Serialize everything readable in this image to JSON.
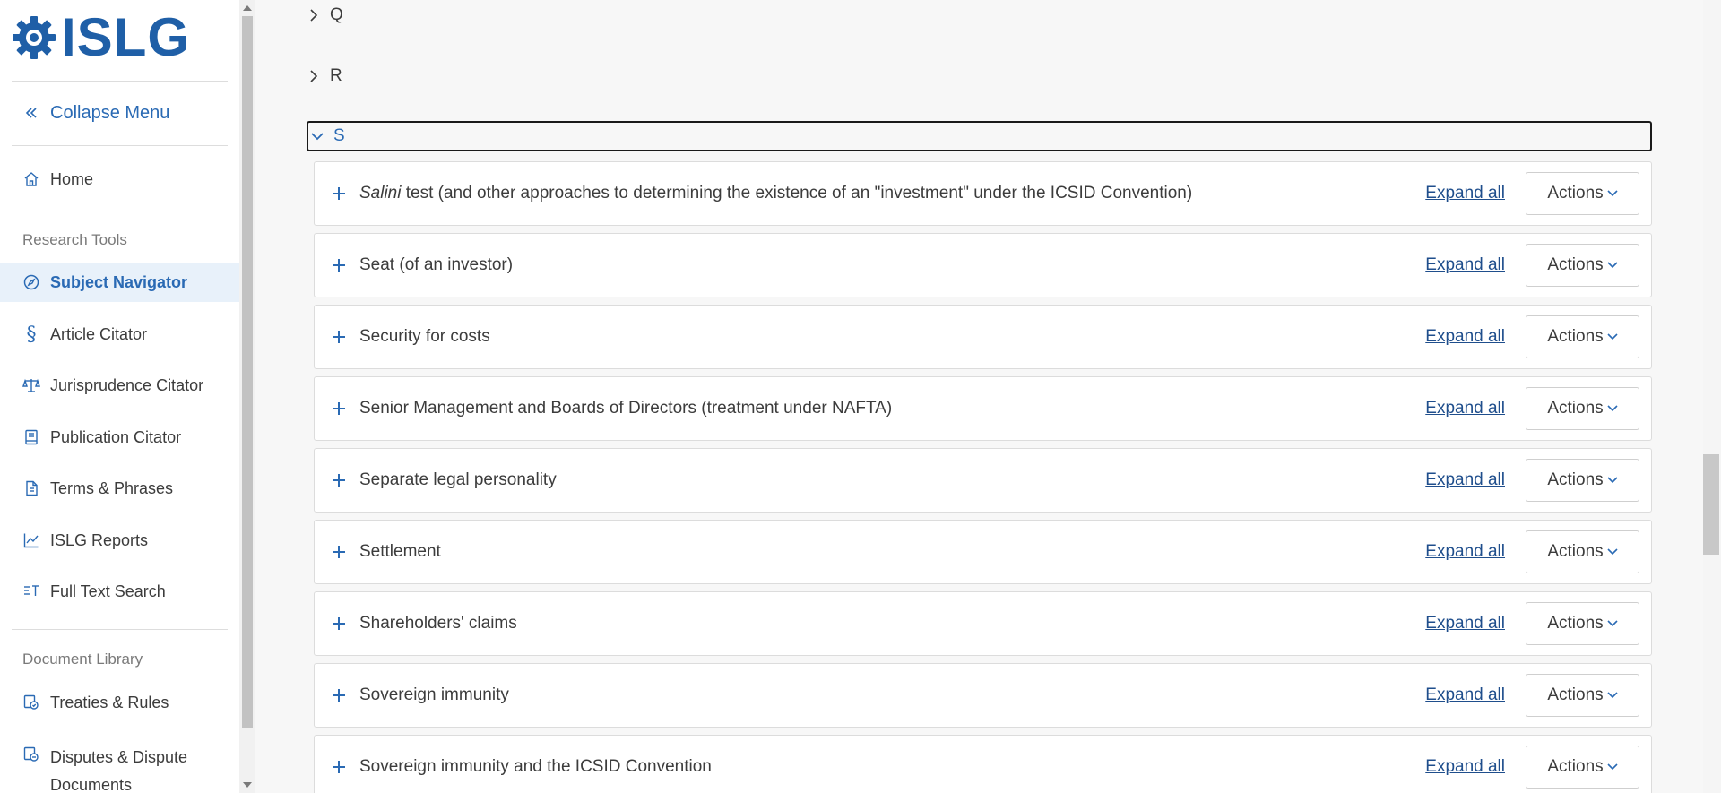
{
  "brand": {
    "name": "ISLG",
    "reg": "®",
    "icon": "gear-logo-icon"
  },
  "sidebar": {
    "collapse_label": "Collapse Menu",
    "home_label": "Home",
    "section_research": "Research Tools",
    "research_items": [
      {
        "label": "Subject Navigator",
        "icon": "compass-icon",
        "active": true
      },
      {
        "label": "Article Citator",
        "icon": "section-icon"
      },
      {
        "label": "Jurisprudence Citator",
        "icon": "scales-icon"
      },
      {
        "label": "Publication Citator",
        "icon": "book-icon"
      },
      {
        "label": "Terms & Phrases",
        "icon": "document-icon"
      },
      {
        "label": "ISLG Reports",
        "icon": "chart-line-icon"
      },
      {
        "label": "Full Text Search",
        "icon": "text-search-icon"
      }
    ],
    "section_library": "Document Library",
    "library_items": [
      {
        "label": "Treaties & Rules",
        "icon": "treaty-icon"
      },
      {
        "label": "Disputes & Dispute",
        "label2": "Documents",
        "icon": "dispute-icon"
      }
    ]
  },
  "main": {
    "letters": [
      {
        "letter": "Q",
        "expanded": false
      },
      {
        "letter": "R",
        "expanded": false
      },
      {
        "letter": "S",
        "expanded": true
      }
    ],
    "expand_label": "Expand all",
    "actions_label": "Actions",
    "topics": [
      {
        "italic": "Salini",
        "rest": " test (and other approaches to determining the existence of an \"investment\" under the ICSID Convention)"
      },
      {
        "italic": "",
        "rest": "Seat (of an investor)"
      },
      {
        "italic": "",
        "rest": "Security for costs"
      },
      {
        "italic": "",
        "rest": "Senior Management and Boards of Directors (treatment under NAFTA)"
      },
      {
        "italic": "",
        "rest": "Separate legal personality"
      },
      {
        "italic": "",
        "rest": "Settlement"
      },
      {
        "italic": "",
        "rest": "Shareholders' claims"
      },
      {
        "italic": "",
        "rest": "Sovereign immunity"
      },
      {
        "italic": "",
        "rest": "Sovereign immunity and the ICSID Convention"
      }
    ]
  },
  "colors": {
    "accent": "#2a6ab4",
    "link": "#1f4e8c",
    "active_bg": "#e8f1fa",
    "brand": "#1f5fa7"
  }
}
